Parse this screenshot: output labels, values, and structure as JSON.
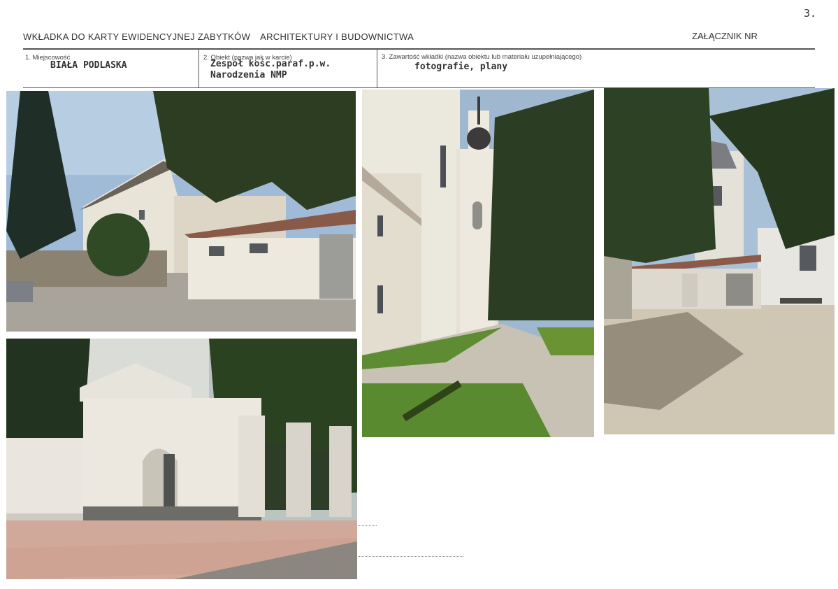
{
  "page_number": "3.",
  "header": {
    "title_part1": "WKŁADKA DO KARTY EWIDENCYJNEJ ZABYTKÓW",
    "title_part2": "ARCHITEKTURY I BUDOWNICTWA",
    "annex_label": "ZAŁĄCZNIK NR"
  },
  "fields": [
    {
      "label": "1. Miejscowość",
      "value_lines": [
        "BIAŁA PODLASKA"
      ]
    },
    {
      "label": "2. Obiekt (nazwa jak w karcie)",
      "value_lines": [
        "Zespół kośc.paraf.p.w.",
        "Narodzenia NMP"
      ]
    },
    {
      "label": "3. Zawartość wkładki (nazwa obiektu lub materiału uzupełniającego)",
      "value_lines": [
        "fotografie, plany"
      ]
    }
  ],
  "photos": [
    {
      "subject": "parish house and outbuilding"
    },
    {
      "subject": "church facade and bell tower"
    },
    {
      "subject": "church courtyard with paved square"
    },
    {
      "subject": "gate in the perimeter wall"
    }
  ]
}
